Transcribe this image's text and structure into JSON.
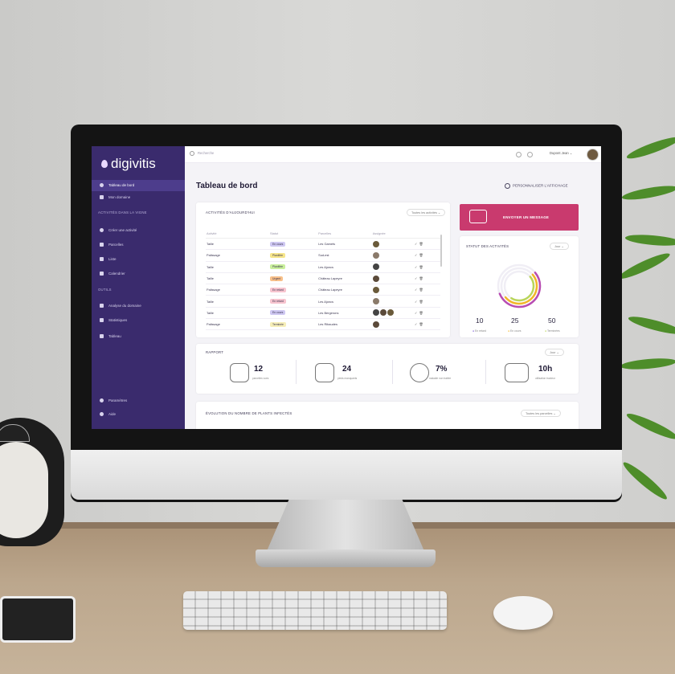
{
  "brand": {
    "name": "digivitis"
  },
  "sidebar": {
    "items": [
      {
        "label": "Tableau de bord",
        "active": true
      },
      {
        "label": "Mon domaine",
        "active": false
      }
    ],
    "section_activities": "ACTIVITÉS DANS LA VIGNE",
    "activity_items": [
      {
        "label": "Créer une activité"
      },
      {
        "label": "Parcelles"
      },
      {
        "label": "Liste"
      },
      {
        "label": "Calendrier"
      }
    ],
    "section_tools": "OUTILS",
    "tool_items": [
      {
        "label": "Analyse du domaine"
      },
      {
        "label": "Statistiques"
      },
      {
        "label": "Tableau"
      }
    ],
    "footer_items": [
      {
        "label": "Paramètres"
      },
      {
        "label": "Aide"
      }
    ]
  },
  "topbar": {
    "search_placeholder": "Recherche",
    "user_name": "Dupont Jean"
  },
  "main": {
    "title": "Tableau de bord",
    "customize_label": "PERSONNALISER L'AFFICHAGE"
  },
  "activities": {
    "title": "ACTIVITÉS D'AUJOURD'HUI",
    "filter_label": "Toutes les activités",
    "columns": [
      "Activité",
      "Statut",
      "Parcelles",
      "Assignée"
    ],
    "rows": [
      {
        "activity": "Taille",
        "status": "En cours",
        "status_color": "#cfc8f2",
        "parcel": "Les Gamets",
        "avatars": 1
      },
      {
        "activity": "Palissage",
        "status": "Planifiée",
        "status_color": "#f6e58a",
        "parcel": "Sud-est",
        "avatars": 1
      },
      {
        "activity": "Taille",
        "status": "Planifiée",
        "status_color": "#c9ef9c",
        "parcel": "Les Ajoncs",
        "avatars": 1
      },
      {
        "activity": "Taille",
        "status": "Urgent",
        "status_color": "#f8c08a",
        "parcel": "Château Lapeyre",
        "avatars": 1
      },
      {
        "activity": "Palissage",
        "status": "En retard",
        "status_color": "#f7c4cf",
        "parcel": "Château Lapeyre",
        "avatars": 1
      },
      {
        "activity": "Taille",
        "status": "En retard",
        "status_color": "#f7c4cf",
        "parcel": "Les Ajoncs",
        "avatars": 1
      },
      {
        "activity": "Taille",
        "status": "En cours",
        "status_color": "#cfc8f2",
        "parcel": "Les Bergerons",
        "avatars": 3
      },
      {
        "activity": "Palissage",
        "status": "Terminée",
        "status_color": "#f6eeb8",
        "parcel": "Les Ribaudes",
        "avatars": 1
      }
    ]
  },
  "message_button": {
    "label": "ENVOYER UN MESSAGE"
  },
  "activity_status": {
    "title": "STATUT DES ACTIVITÉS",
    "period": "Jour",
    "rings": [
      {
        "color": "#b84cb2",
        "fraction": 0.55
      },
      {
        "color": "#f2b62a",
        "fraction": 0.5
      },
      {
        "color": "#b9d65a",
        "fraction": 0.45
      }
    ],
    "stats": [
      {
        "value": "10",
        "label": "En retard",
        "color": "#7b5bd6"
      },
      {
        "value": "25",
        "label": "En cours",
        "color": "#f2b62a"
      },
      {
        "value": "50",
        "label": "Terminées",
        "color": "#b9d65a"
      }
    ]
  },
  "report": {
    "title": "RAPPORT",
    "period": "Jour",
    "kpis": [
      {
        "value": "12",
        "label": "parcelles vues",
        "icon": "leaf-icon"
      },
      {
        "value": "24",
        "label": "pieds manquants",
        "icon": "vine-leaf-icon"
      },
      {
        "value": "7%",
        "label": "maladie non traitée",
        "icon": "grape-icon"
      },
      {
        "value": "10h",
        "label": "utilisation tracteur",
        "icon": "tractor-icon"
      }
    ]
  },
  "evolution": {
    "title": "ÉVOLUTION DU NOMBRE DE PLANTS INFECTÉS",
    "filter_label": "Toutes les parcelles"
  }
}
